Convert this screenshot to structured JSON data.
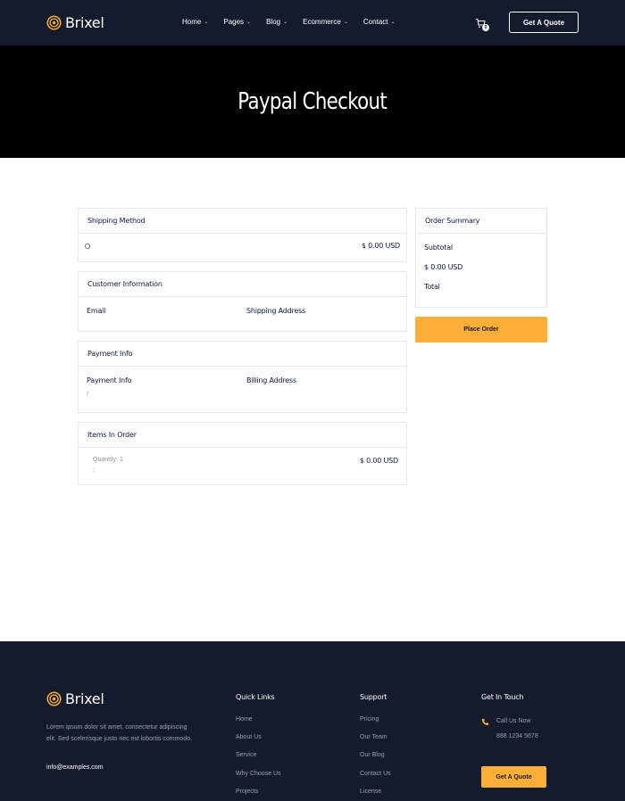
{
  "header": {
    "logo_text": "Brixel",
    "nav": [
      {
        "label": "Home"
      },
      {
        "label": "Pages"
      },
      {
        "label": "Blog"
      },
      {
        "label": "Ecommerce"
      },
      {
        "label": "Contact"
      }
    ],
    "cart_count": "0",
    "quote_label": "Get A Quote"
  },
  "hero": {
    "title": "Paypal Checkout"
  },
  "shipping": {
    "title": "Shipping Method",
    "price": "$ 0.00 USD"
  },
  "customer": {
    "title": "Customer Information",
    "email_label": "Email",
    "address_label": "Shipping Address"
  },
  "payment": {
    "title": "Payment Info",
    "info_label": "Payment Info",
    "billing_label": "Billing Address",
    "info_value": "/"
  },
  "items": {
    "title": "Items In Order",
    "quantity": "Quantity: 1",
    "sub": ":",
    "price": "$ 0.00 USD"
  },
  "summary": {
    "title": "Order Summary",
    "subtotal_label": "Subtotal",
    "subtotal_value": "$ 0.00 USD",
    "total_label": "Total",
    "place_order": "Place Order"
  },
  "footer": {
    "logo_text": "Brixel",
    "description_line1": "Lorem ipsum dolor sit amet, consectetur adipiscing",
    "description_line2": "elit. Sed scelerisque justo nec est lobortis commodo.",
    "email": "info@examples.com",
    "quick_links": {
      "title": "Quick Links",
      "items": [
        "Home",
        "About Us",
        "Service",
        "Why Choose Us",
        "Projects"
      ]
    },
    "support": {
      "title": "Support",
      "items": [
        "Pricing",
        "Our Team",
        "Our Blog",
        "Contact Us",
        "License"
      ]
    },
    "contact": {
      "title": "Get In Touch",
      "call_label": "Call Us Now",
      "phone": "888 1234 5678",
      "quote_label": "Get A Quote"
    }
  },
  "colors": {
    "navy": "#141b2d",
    "accent": "#fdae37",
    "text": "#0d1b3e"
  }
}
